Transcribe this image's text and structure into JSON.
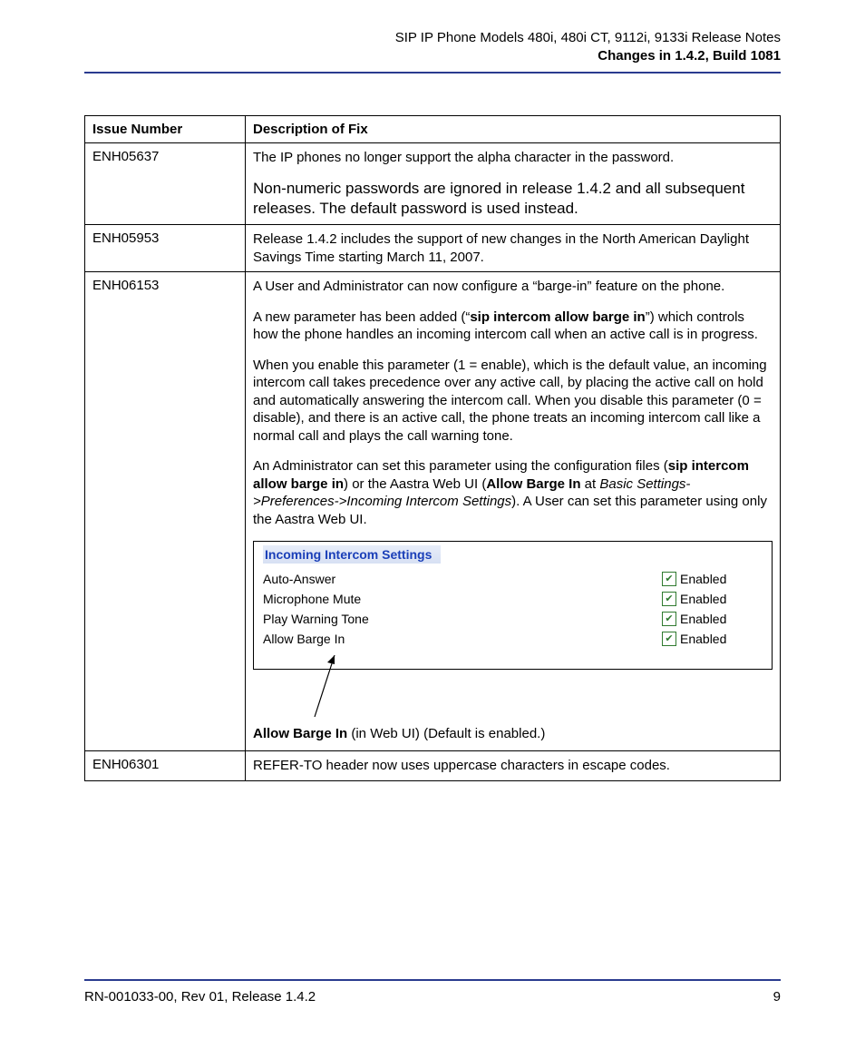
{
  "header": {
    "line1": "SIP IP Phone Models 480i, 480i CT, 9112i, 9133i Release Notes",
    "line2": "Changes in 1.4.2, Build 1081"
  },
  "table": {
    "headers": {
      "issue": "Issue Number",
      "desc": "Description of Fix"
    },
    "rows": [
      {
        "issue": "ENH05637",
        "desc": {
          "p1": "The IP phones no longer support the alpha character in the password.",
          "p2": "Non-numeric passwords are ignored in release 1.4.2 and all subsequent releases. The default password is used instead."
        }
      },
      {
        "issue": "ENH05953",
        "desc": {
          "p1": "Release 1.4.2 includes the support of new changes in the North American Daylight Savings Time starting March 11, 2007."
        }
      },
      {
        "issue": "ENH06153",
        "desc": {
          "p1": "A User and Administrator can now configure a “barge-in” feature on the phone.",
          "p2a": "A new parameter has been added (“",
          "p2b": "sip intercom allow barge in",
          "p2c": "”) which controls how the phone handles an incoming intercom call when an active call is in progress.",
          "p3": "When you enable this parameter (1 = enable), which is the default value, an incoming intercom call takes precedence over any active call, by placing the active call on hold and automatically answering the intercom call. When you disable this parameter (0 = disable), and there is an active call, the phone treats an incoming intercom call like a normal call and plays the call warning tone.",
          "p4a": "An Administrator can set this parameter using the configuration files (",
          "p4b": "sip intercom allow barge in",
          "p4c": ") or the Aastra Web UI (",
          "p4d": "Allow Barge In",
          "p4e": " at ",
          "p4f": "Basic Settings->Preferences->Incoming Intercom Settings",
          "p4g": "). A User can set this parameter using only the Aastra Web UI.",
          "webui": {
            "title": "Incoming Intercom Settings",
            "options": [
              {
                "label": "Auto-Answer",
                "state": "Enabled"
              },
              {
                "label": "Microphone Mute",
                "state": "Enabled"
              },
              {
                "label": "Play Warning Tone",
                "state": "Enabled"
              },
              {
                "label": "Allow Barge In",
                "state": "Enabled"
              }
            ]
          },
          "caption_bold": "Allow Barge In",
          "caption_rest": " (in Web UI) (Default is enabled.)"
        }
      },
      {
        "issue": "ENH06301",
        "desc": {
          "p1": "REFER-TO header now uses uppercase characters in escape codes."
        }
      }
    ]
  },
  "footer": {
    "left": "RN-001033-00, Rev 01, Release 1.4.2",
    "right": "9"
  }
}
